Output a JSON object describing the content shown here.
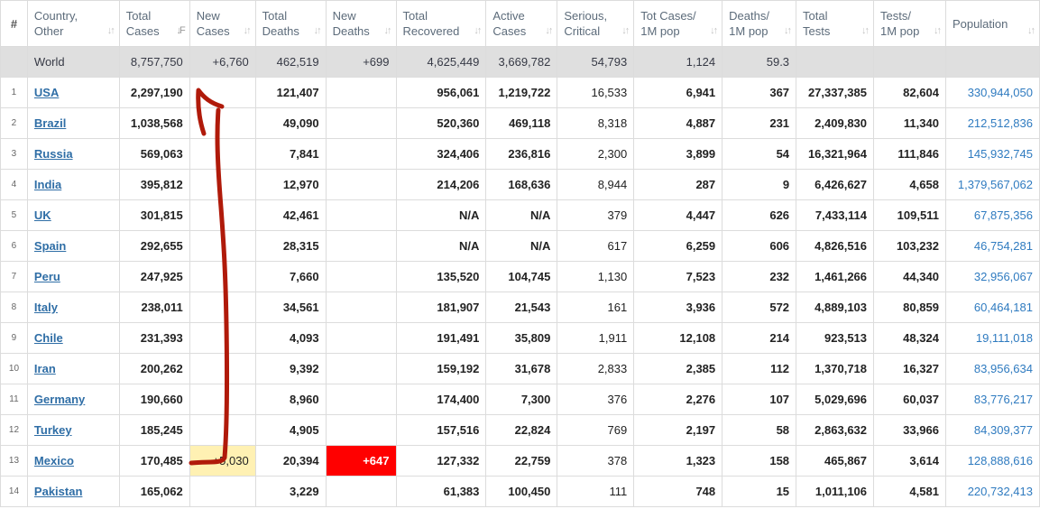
{
  "headers": {
    "idx": "#",
    "country": [
      "Country,",
      "Other"
    ],
    "total_cases": [
      "Total",
      "Cases"
    ],
    "new_cases": [
      "New",
      "Cases"
    ],
    "total_deaths": [
      "Total",
      "Deaths"
    ],
    "new_deaths": [
      "New",
      "Deaths"
    ],
    "total_recovered": [
      "Total",
      "Recovered"
    ],
    "active_cases": [
      "Active",
      "Cases"
    ],
    "serious_critical": [
      "Serious,",
      "Critical"
    ],
    "tot_cases_1m": [
      "Tot Cases/",
      "1M pop"
    ],
    "deaths_1m": [
      "Deaths/",
      "1M pop"
    ],
    "total_tests": [
      "Total",
      "Tests"
    ],
    "tests_1m": [
      "Tests/",
      "1M pop"
    ],
    "population": [
      "Population",
      ""
    ]
  },
  "world": {
    "country": "World",
    "total_cases": "8,757,750",
    "new_cases": "+6,760",
    "total_deaths": "462,519",
    "new_deaths": "+699",
    "total_recovered": "4,625,449",
    "active_cases": "3,669,782",
    "serious_critical": "54,793",
    "tot_cases_1m": "1,124",
    "deaths_1m": "59.3",
    "total_tests": "",
    "tests_1m": "",
    "population": ""
  },
  "rows": [
    {
      "idx": "1",
      "country": "USA",
      "total_cases": "2,297,190",
      "new_cases": "",
      "total_deaths": "121,407",
      "new_deaths": "",
      "total_recovered": "956,061",
      "active_cases": "1,219,722",
      "serious_critical": "16,533",
      "tot_cases_1m": "6,941",
      "deaths_1m": "367",
      "total_tests": "27,337,385",
      "tests_1m": "82,604",
      "population": "330,944,050"
    },
    {
      "idx": "2",
      "country": "Brazil",
      "total_cases": "1,038,568",
      "new_cases": "",
      "total_deaths": "49,090",
      "new_deaths": "",
      "total_recovered": "520,360",
      "active_cases": "469,118",
      "serious_critical": "8,318",
      "tot_cases_1m": "4,887",
      "deaths_1m": "231",
      "total_tests": "2,409,830",
      "tests_1m": "11,340",
      "population": "212,512,836"
    },
    {
      "idx": "3",
      "country": "Russia",
      "total_cases": "569,063",
      "new_cases": "",
      "total_deaths": "7,841",
      "new_deaths": "",
      "total_recovered": "324,406",
      "active_cases": "236,816",
      "serious_critical": "2,300",
      "tot_cases_1m": "3,899",
      "deaths_1m": "54",
      "total_tests": "16,321,964",
      "tests_1m": "111,846",
      "population": "145,932,745"
    },
    {
      "idx": "4",
      "country": "India",
      "total_cases": "395,812",
      "new_cases": "",
      "total_deaths": "12,970",
      "new_deaths": "",
      "total_recovered": "214,206",
      "active_cases": "168,636",
      "serious_critical": "8,944",
      "tot_cases_1m": "287",
      "deaths_1m": "9",
      "total_tests": "6,426,627",
      "tests_1m": "4,658",
      "population": "1,379,567,062"
    },
    {
      "idx": "5",
      "country": "UK",
      "total_cases": "301,815",
      "new_cases": "",
      "total_deaths": "42,461",
      "new_deaths": "",
      "total_recovered": "N/A",
      "active_cases": "N/A",
      "serious_critical": "379",
      "tot_cases_1m": "4,447",
      "deaths_1m": "626",
      "total_tests": "7,433,114",
      "tests_1m": "109,511",
      "population": "67,875,356"
    },
    {
      "idx": "6",
      "country": "Spain",
      "total_cases": "292,655",
      "new_cases": "",
      "total_deaths": "28,315",
      "new_deaths": "",
      "total_recovered": "N/A",
      "active_cases": "N/A",
      "serious_critical": "617",
      "tot_cases_1m": "6,259",
      "deaths_1m": "606",
      "total_tests": "4,826,516",
      "tests_1m": "103,232",
      "population": "46,754,281"
    },
    {
      "idx": "7",
      "country": "Peru",
      "total_cases": "247,925",
      "new_cases": "",
      "total_deaths": "7,660",
      "new_deaths": "",
      "total_recovered": "135,520",
      "active_cases": "104,745",
      "serious_critical": "1,130",
      "tot_cases_1m": "7,523",
      "deaths_1m": "232",
      "total_tests": "1,461,266",
      "tests_1m": "44,340",
      "population": "32,956,067"
    },
    {
      "idx": "8",
      "country": "Italy",
      "total_cases": "238,011",
      "new_cases": "",
      "total_deaths": "34,561",
      "new_deaths": "",
      "total_recovered": "181,907",
      "active_cases": "21,543",
      "serious_critical": "161",
      "tot_cases_1m": "3,936",
      "deaths_1m": "572",
      "total_tests": "4,889,103",
      "tests_1m": "80,859",
      "population": "60,464,181"
    },
    {
      "idx": "9",
      "country": "Chile",
      "total_cases": "231,393",
      "new_cases": "",
      "total_deaths": "4,093",
      "new_deaths": "",
      "total_recovered": "191,491",
      "active_cases": "35,809",
      "serious_critical": "1,911",
      "tot_cases_1m": "12,108",
      "deaths_1m": "214",
      "total_tests": "923,513",
      "tests_1m": "48,324",
      "population": "19,111,018"
    },
    {
      "idx": "10",
      "country": "Iran",
      "total_cases": "200,262",
      "new_cases": "",
      "total_deaths": "9,392",
      "new_deaths": "",
      "total_recovered": "159,192",
      "active_cases": "31,678",
      "serious_critical": "2,833",
      "tot_cases_1m": "2,385",
      "deaths_1m": "112",
      "total_tests": "1,370,718",
      "tests_1m": "16,327",
      "population": "83,956,634"
    },
    {
      "idx": "11",
      "country": "Germany",
      "total_cases": "190,660",
      "new_cases": "",
      "total_deaths": "8,960",
      "new_deaths": "",
      "total_recovered": "174,400",
      "active_cases": "7,300",
      "serious_critical": "376",
      "tot_cases_1m": "2,276",
      "deaths_1m": "107",
      "total_tests": "5,029,696",
      "tests_1m": "60,037",
      "population": "83,776,217"
    },
    {
      "idx": "12",
      "country": "Turkey",
      "total_cases": "185,245",
      "new_cases": "",
      "total_deaths": "4,905",
      "new_deaths": "",
      "total_recovered": "157,516",
      "active_cases": "22,824",
      "serious_critical": "769",
      "tot_cases_1m": "2,197",
      "deaths_1m": "58",
      "total_tests": "2,863,632",
      "tests_1m": "33,966",
      "population": "84,309,377"
    },
    {
      "idx": "13",
      "country": "Mexico",
      "total_cases": "170,485",
      "new_cases": "+5,030",
      "total_deaths": "20,394",
      "new_deaths": "+647",
      "total_recovered": "127,332",
      "active_cases": "22,759",
      "serious_critical": "378",
      "tot_cases_1m": "1,323",
      "deaths_1m": "158",
      "total_tests": "465,867",
      "tests_1m": "3,614",
      "population": "128,888,616"
    },
    {
      "idx": "14",
      "country": "Pakistan",
      "total_cases": "165,062",
      "new_cases": "",
      "total_deaths": "3,229",
      "new_deaths": "",
      "total_recovered": "61,383",
      "active_cases": "100,450",
      "serious_critical": "111",
      "tot_cases_1m": "748",
      "deaths_1m": "15",
      "total_tests": "1,011,106",
      "tests_1m": "4,581",
      "population": "220,732,413"
    }
  ],
  "colors": {
    "link": "#2f6ea6",
    "population": "#2f7bc0",
    "new_cases_highlight": "#fff1b3",
    "new_deaths_highlight": "#ff0000",
    "annotation_arrow": "#b01a0a",
    "world_row": "#dfdfdf"
  }
}
